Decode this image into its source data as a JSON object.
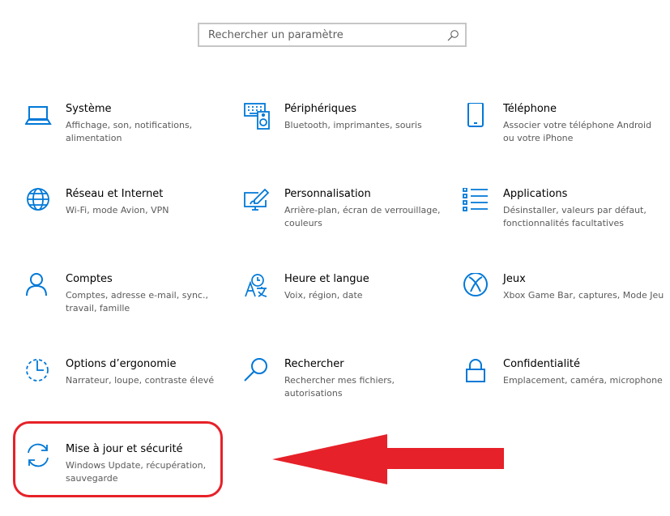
{
  "search": {
    "placeholder": "Rechercher un paramètre",
    "icon": "search-icon"
  },
  "accent_color": "#0078d7",
  "annotation_color": "#e62129",
  "tiles": [
    {
      "title": "Système",
      "desc": "Affichage, son, notifications, alimentation",
      "icon": "laptop-icon"
    },
    {
      "title": "Périphériques",
      "desc": "Bluetooth, imprimantes, souris",
      "icon": "keyboard-speaker-icon"
    },
    {
      "title": "Téléphone",
      "desc": "Associer votre téléphone Android ou votre iPhone",
      "icon": "phone-icon"
    },
    {
      "title": "Réseau et Internet",
      "desc": "Wi-Fi, mode Avion, VPN",
      "icon": "globe-icon"
    },
    {
      "title": "Personnalisation",
      "desc": "Arrière-plan, écran de verrouillage, couleurs",
      "icon": "paint-monitor-icon"
    },
    {
      "title": "Applications",
      "desc": "Désinstaller, valeurs par défaut, fonctionnalités facultatives",
      "icon": "apps-list-icon"
    },
    {
      "title": "Comptes",
      "desc": "Comptes, adresse e-mail, sync., travail, famille",
      "icon": "person-icon"
    },
    {
      "title": "Heure et langue",
      "desc": "Voix, région, date",
      "icon": "time-language-icon"
    },
    {
      "title": "Jeux",
      "desc": "Xbox Game Bar, captures, Mode Jeu",
      "icon": "xbox-icon"
    },
    {
      "title": "Options d’ergonomie",
      "desc": "Narrateur, loupe, contraste élevé",
      "icon": "ease-of-access-icon"
    },
    {
      "title": "Rechercher",
      "desc": "Rechercher mes fichiers, autorisations",
      "icon": "magnifier-icon"
    },
    {
      "title": "Confidentialité",
      "desc": "Emplacement, caméra, microphone",
      "icon": "lock-icon"
    },
    {
      "title": "Mise à jour et sécurité",
      "desc": "Windows Update, récupération, sauvegarde",
      "icon": "update-sync-icon"
    }
  ]
}
